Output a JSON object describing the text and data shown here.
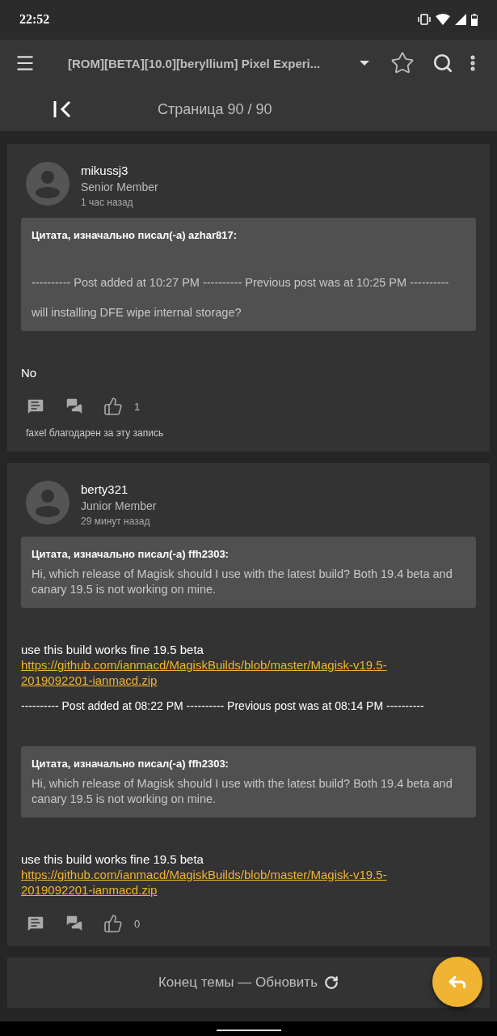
{
  "status_bar": {
    "time": "22:52"
  },
  "toolbar": {
    "title": "[ROM][BETA][10.0][beryllium] Pixel Experi..."
  },
  "pager": {
    "label": "Страница 90 / 90"
  },
  "posts": [
    {
      "author": "mikussj3",
      "role": "Senior Member",
      "time": "1 час назад",
      "content": [
        {
          "kind": "quote",
          "title": "Цитата, изначально писал(-а) azhar817:",
          "paragraphs": [
            "---------- Post added at 10:27 PM ---------- Previous post was at 10:25 PM ----------",
            "will installing DFE wipe internal storage?"
          ],
          "spaced": true
        },
        {
          "kind": "text",
          "text": "No"
        }
      ],
      "likes": "1",
      "thanks": "faxel благодарен за эту запись"
    },
    {
      "author": "berty321",
      "role": "Junior Member",
      "time": "29 минут назад",
      "content": [
        {
          "kind": "quote",
          "title": "Цитата, изначально писал(-а) ffh2303:",
          "paragraphs": [
            "Hi, which release of Magisk should I use with the latest build? Both 19.4 beta and canary 19.5 is not working on mine."
          ],
          "spaced": false
        },
        {
          "kind": "text",
          "text": "use this build works fine 19.5 beta"
        },
        {
          "kind": "link",
          "text": "https://github.com/ianmacd/MagiskBuilds/blob/master/Magisk-v19.5-2019092201-ianmacd.zip"
        },
        {
          "kind": "separator",
          "text": "---------- Post added at 08:22 PM ---------- Previous post was at 08:14 PM ----------"
        },
        {
          "kind": "quote",
          "title": "Цитата, изначально писал(-а) ffh2303:",
          "paragraphs": [
            "Hi, which release of Magisk should I use with the latest build? Both 19.4 beta and canary 19.5 is not working on mine."
          ],
          "spaced": false
        },
        {
          "kind": "text",
          "text": "use this build works fine 19.5 beta"
        },
        {
          "kind": "link",
          "text": "https://github.com/ianmacd/MagiskBuilds/blob/master/Magisk-v19.5-2019092201-ianmacd.zip"
        }
      ],
      "likes": "0"
    }
  ],
  "footer": {
    "label": "Конец темы — Обновить"
  }
}
